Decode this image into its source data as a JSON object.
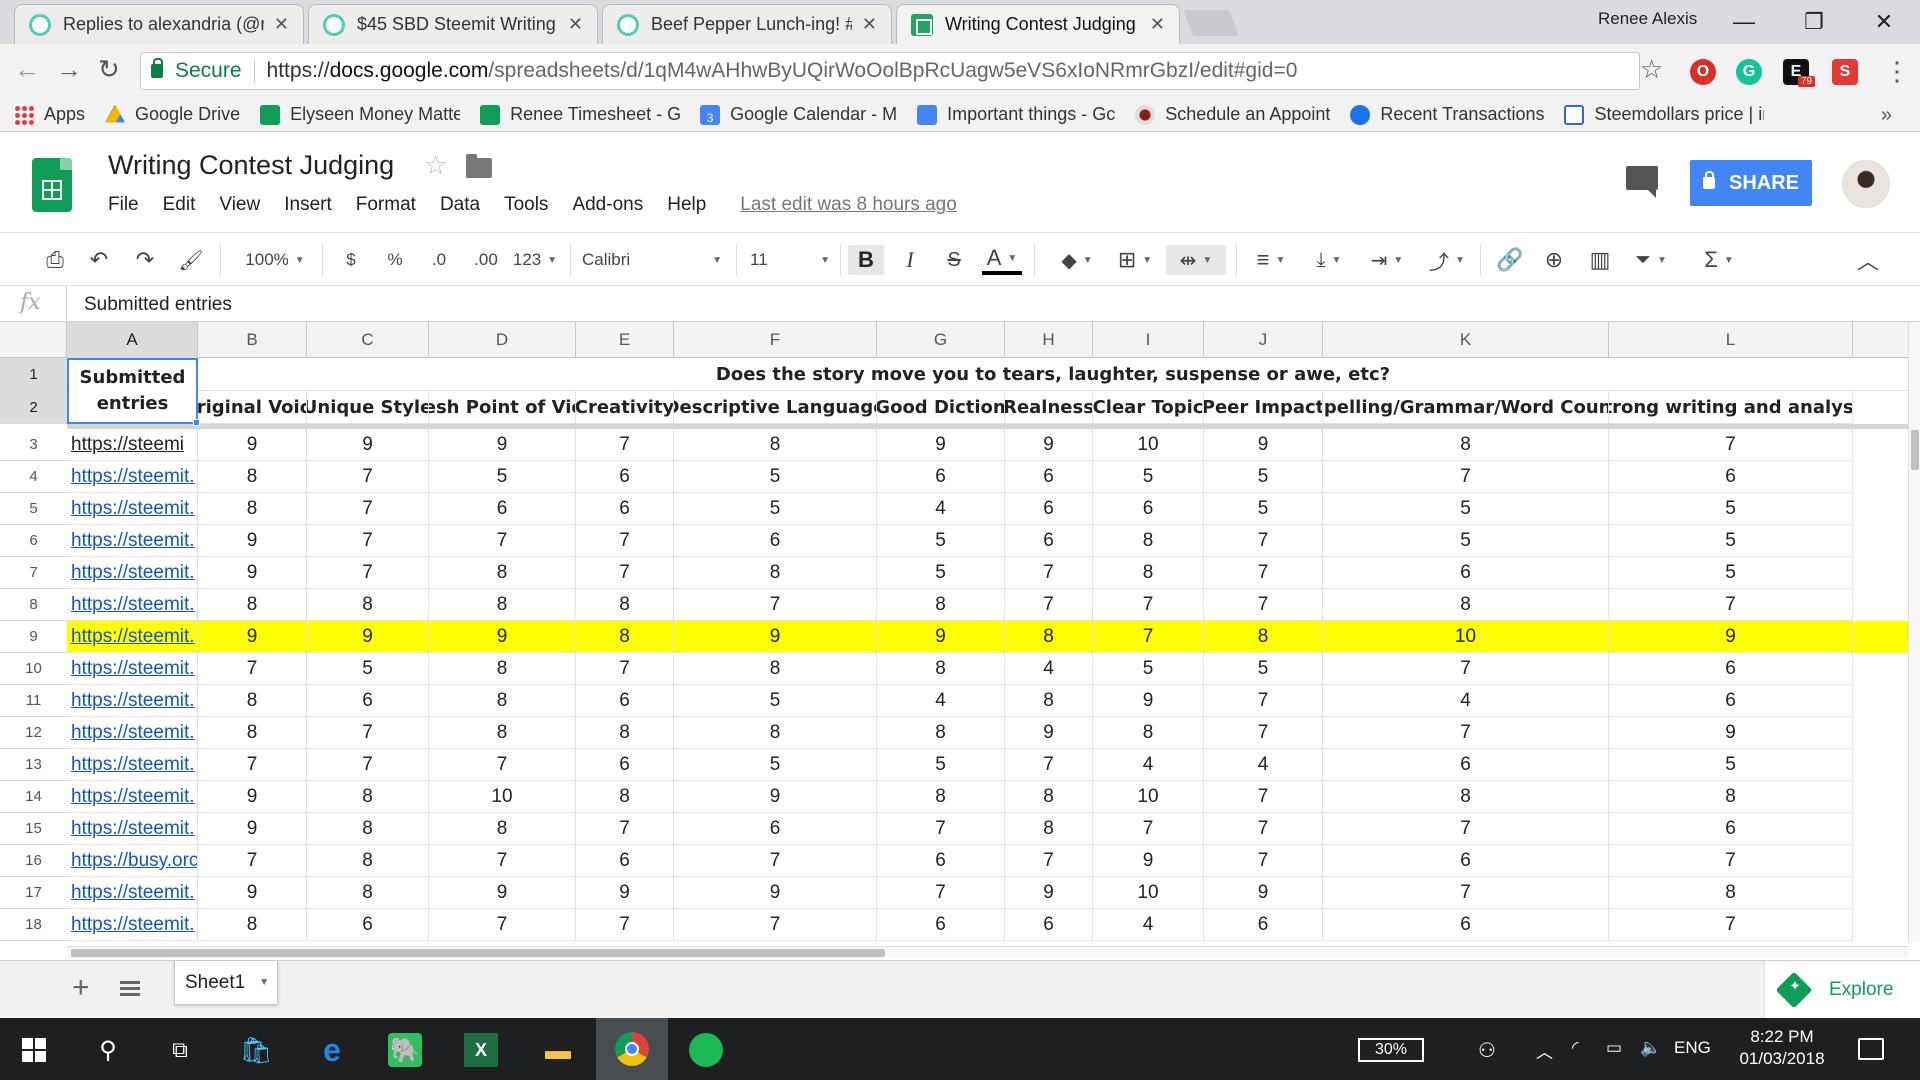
{
  "browser": {
    "tabs": [
      {
        "title": "Replies to alexandria (@r",
        "favicon": "steem-icon",
        "active": false
      },
      {
        "title": "$45 SBD Steemit Writing",
        "favicon": "steem-icon",
        "active": false
      },
      {
        "title": "Beef Pepper Lunch-ing! #",
        "favicon": "steem-icon",
        "active": false
      },
      {
        "title": "Writing Contest Judging",
        "favicon": "sheets-icon",
        "active": true
      }
    ],
    "user": "Renee Alexis",
    "secure_label": "Secure",
    "url_scheme": "https://",
    "url_host": "docs.google.com",
    "url_path": "/spreadsheets/d/1qM4wAHhwByUQirWoOolBpRcUagw5eVS6xIoNRmrGbzI/edit#gid=0",
    "extension_badge": "79",
    "bookmarks": [
      {
        "label": "Apps",
        "icon": "apps-grid-icon",
        "color": "#4285f4"
      },
      {
        "label": "Google Drive",
        "icon": "drive-icon",
        "color": "#f4b400"
      },
      {
        "label": "Elyseen Money Matte",
        "icon": "sheets-icon",
        "color": "#0f9d58"
      },
      {
        "label": "Renee Timesheet - Gc",
        "icon": "sheets-icon",
        "color": "#0f9d58"
      },
      {
        "label": "Google Calendar - M",
        "icon": "calendar-icon",
        "color": "#4285f4"
      },
      {
        "label": "Important things - Gc",
        "icon": "docs-icon",
        "color": "#4285f4"
      },
      {
        "label": "Schedule an Appoint",
        "icon": "seal-icon",
        "color": "#8b1a1a"
      },
      {
        "label": "Recent Transactions",
        "icon": "c-icon",
        "color": "#1a73e8"
      },
      {
        "label": "Steemdollars price | ir",
        "icon": "wci-icon",
        "color": "#3367d6"
      }
    ],
    "calendar_icon_day": "3"
  },
  "doc": {
    "title": "Writing Contest Judging",
    "menu": [
      "File",
      "Edit",
      "View",
      "Insert",
      "Format",
      "Data",
      "Tools",
      "Add-ons",
      "Help"
    ],
    "last_edit": "Last edit was 8 hours ago",
    "share_label": "SHARE"
  },
  "toolbar": {
    "zoom": "100%",
    "currency": "$",
    "percent": "%",
    "dec_decrease": ".0",
    "dec_increase": ".00",
    "format_more": "123",
    "font": "Calibri",
    "font_size": "11",
    "bold": "B",
    "italic": "I",
    "strike": "S",
    "text_color": "A",
    "sigma": "Σ"
  },
  "formula_bar": {
    "fx": "fx",
    "value": "Submitted entries"
  },
  "sheet": {
    "columns": [
      "A",
      "B",
      "C",
      "D",
      "E",
      "F",
      "G",
      "H",
      "I",
      "J",
      "K",
      "L"
    ],
    "header_a": "Submitted entries",
    "question": "Does the story move you to tears, laughter, suspense or awe, etc?",
    "criteria": [
      "Original Voice",
      "Unique Style",
      "Fresh Point of View",
      "Creativity",
      "Descriptive Language",
      "Good Diction",
      "Realness",
      "Clear Topic",
      "Peer Impact",
      "Spelling/Grammar/Word Count",
      "Strong writing and analysis"
    ],
    "row_numbers": [
      "1",
      "2",
      "3",
      "4",
      "5",
      "6",
      "7",
      "8",
      "9",
      "10",
      "11",
      "12",
      "13",
      "14",
      "15",
      "16",
      "17",
      "18"
    ],
    "rows": [
      {
        "link": "https://steemi",
        "scores": [
          "9",
          "9",
          "9",
          "7",
          "8",
          "9",
          "9",
          "10",
          "9",
          "8",
          "7"
        ],
        "highlight": false
      },
      {
        "link": "https://steemit.",
        "scores": [
          "8",
          "7",
          "5",
          "6",
          "5",
          "6",
          "6",
          "5",
          "5",
          "7",
          "6"
        ],
        "highlight": false
      },
      {
        "link": "https://steemit.",
        "scores": [
          "8",
          "7",
          "6",
          "6",
          "5",
          "4",
          "6",
          "6",
          "5",
          "5",
          "5"
        ],
        "highlight": false
      },
      {
        "link": "https://steemit.",
        "scores": [
          "9",
          "7",
          "7",
          "7",
          "6",
          "5",
          "6",
          "8",
          "7",
          "5",
          "5"
        ],
        "highlight": false
      },
      {
        "link": "https://steemit.",
        "scores": [
          "9",
          "7",
          "8",
          "7",
          "8",
          "5",
          "7",
          "8",
          "7",
          "6",
          "5"
        ],
        "highlight": false
      },
      {
        "link": "https://steemit.",
        "scores": [
          "8",
          "8",
          "8",
          "8",
          "7",
          "8",
          "7",
          "7",
          "7",
          "8",
          "7"
        ],
        "highlight": false
      },
      {
        "link": "https://steemit.",
        "scores": [
          "9",
          "9",
          "9",
          "8",
          "9",
          "9",
          "8",
          "7",
          "8",
          "10",
          "9"
        ],
        "highlight": true
      },
      {
        "link": "https://steemit.",
        "scores": [
          "7",
          "5",
          "8",
          "7",
          "8",
          "8",
          "4",
          "5",
          "5",
          "7",
          "6"
        ],
        "highlight": false
      },
      {
        "link": "https://steemit.",
        "scores": [
          "8",
          "6",
          "8",
          "6",
          "5",
          "4",
          "8",
          "9",
          "7",
          "4",
          "6"
        ],
        "highlight": false
      },
      {
        "link": "https://steemit.",
        "scores": [
          "8",
          "7",
          "8",
          "8",
          "8",
          "8",
          "9",
          "8",
          "7",
          "7",
          "9"
        ],
        "highlight": false
      },
      {
        "link": "https://steemit.",
        "scores": [
          "7",
          "7",
          "7",
          "6",
          "5",
          "5",
          "7",
          "4",
          "4",
          "6",
          "5"
        ],
        "highlight": false
      },
      {
        "link": "https://steemit.",
        "scores": [
          "9",
          "8",
          "10",
          "8",
          "9",
          "8",
          "8",
          "10",
          "7",
          "8",
          "8"
        ],
        "highlight": false
      },
      {
        "link": "https://steemit.",
        "scores": [
          "9",
          "8",
          "8",
          "7",
          "6",
          "7",
          "8",
          "7",
          "7",
          "7",
          "6"
        ],
        "highlight": false
      },
      {
        "link": "https://busy.orc",
        "scores": [
          "7",
          "8",
          "7",
          "6",
          "7",
          "6",
          "7",
          "9",
          "7",
          "6",
          "7"
        ],
        "highlight": false
      },
      {
        "link": "https://steemit.",
        "scores": [
          "9",
          "8",
          "9",
          "9",
          "9",
          "7",
          "9",
          "10",
          "9",
          "7",
          "8"
        ],
        "highlight": false
      },
      {
        "link": "https://steemit.",
        "scores": [
          "8",
          "6",
          "7",
          "7",
          "7",
          "6",
          "6",
          "4",
          "6",
          "6",
          "7"
        ],
        "highlight": false
      }
    ],
    "highlight_color": "#ffff00",
    "link_color": "#1155cc",
    "tab_name": "Sheet1",
    "explore_label": "Explore"
  },
  "taskbar": {
    "battery": "30%",
    "language": "ENG",
    "time": "8:22 PM",
    "date": "01/03/2018"
  }
}
